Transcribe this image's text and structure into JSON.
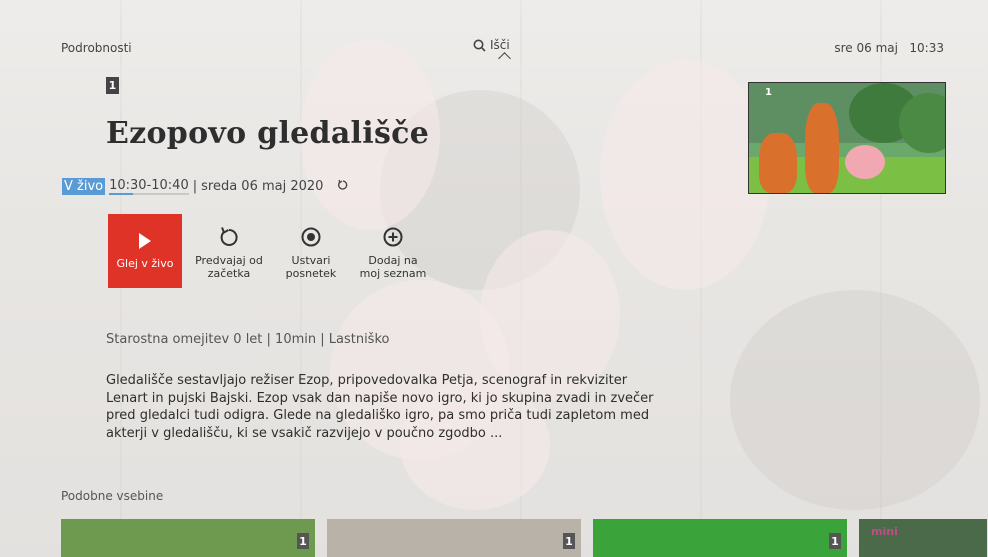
{
  "topbar": {
    "section": "Podrobnosti",
    "search_label": "Išči",
    "date": "sre 06 maj",
    "time": "10:33"
  },
  "program": {
    "channel_number": "1",
    "title": "Ezopovo gledališče",
    "live_tag": "V živo",
    "time_range": "10:30-10:40",
    "separator": "|",
    "date_text": "sreda 06 maj 2020",
    "progress": 0.3,
    "restrictions": "Starostna omejitev 0 let | 10min | Lastniško",
    "description": "Gledališče sestavljajo režiser Ezop, pripovedovalka Petja, scenograf in rekviziter Lenart in pujski Bajski. Ezop vsak dan napiše novo igro, ki jo skupina zvadi in zvečer pred gledalci tudi odigra. Glede na gledališko igro, pa smo priča tudi zapletom med akterji v gledališču, ki se vsakič razvijejo v poučno zgodbo ..."
  },
  "actions": {
    "watch_live": "Glej v živo",
    "restart": "Predvajaj od začetka",
    "record": "Ustvari posnetek",
    "add_list": "Dodaj na moj seznam"
  },
  "preview": {
    "channel_number": "1"
  },
  "similar": {
    "label": "Podobne vsebine",
    "cards": [
      {
        "channel": "1",
        "color": "#6d9a4f"
      },
      {
        "channel": "1",
        "color": "#b8b2a8"
      },
      {
        "channel": "1",
        "color": "#3aa43a"
      },
      {
        "channel": "",
        "color": "#4a6a4a",
        "text": "mini"
      }
    ]
  },
  "colors": {
    "accent_live": "#e03327",
    "live_tag": "#5b9bd5"
  }
}
